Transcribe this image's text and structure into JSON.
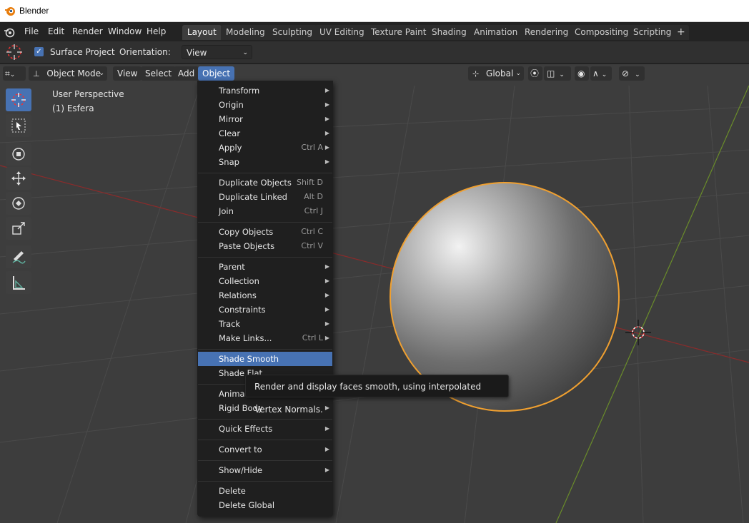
{
  "window": {
    "title": "Blender"
  },
  "topmenu": [
    "File",
    "Edit",
    "Render",
    "Window",
    "Help"
  ],
  "workspaces": [
    {
      "label": "Layout",
      "active": true
    },
    {
      "label": "Modeling"
    },
    {
      "label": "Sculpting"
    },
    {
      "label": "UV Editing"
    },
    {
      "label": "Texture Paint"
    },
    {
      "label": "Shading"
    },
    {
      "label": "Animation"
    },
    {
      "label": "Rendering"
    },
    {
      "label": "Compositing"
    },
    {
      "label": "Scripting"
    }
  ],
  "add_workspace": "+",
  "tool_settings": {
    "surface_project_label": "Surface Project",
    "surface_project_checked": true,
    "orientation_label": "Orientation:",
    "orientation_value": "View"
  },
  "viewport_header": {
    "mode": "Object Mode",
    "menus": [
      "View",
      "Select",
      "Add",
      "Object"
    ],
    "transform_orientation": "Global"
  },
  "viewport": {
    "perspective": "User Perspective",
    "active_object": "(1) Esfera"
  },
  "object_menu": {
    "items": [
      {
        "label": "Transform",
        "submenu": true
      },
      {
        "label": "Origin",
        "submenu": true
      },
      {
        "label": "Mirror",
        "submenu": true
      },
      {
        "label": "Clear",
        "submenu": true
      },
      {
        "label": "Apply",
        "shortcut": "Ctrl A",
        "submenu": true
      },
      {
        "label": "Snap",
        "submenu": true
      },
      {
        "label": "Duplicate Objects",
        "shortcut": "Shift D"
      },
      {
        "label": "Duplicate Linked",
        "shortcut": "Alt D"
      },
      {
        "label": "Join",
        "shortcut": "Ctrl J"
      },
      {
        "label": "Copy Objects",
        "shortcut": "Ctrl C"
      },
      {
        "label": "Paste Objects",
        "shortcut": "Ctrl V"
      },
      {
        "label": "Parent",
        "submenu": true
      },
      {
        "label": "Collection",
        "submenu": true
      },
      {
        "label": "Relations",
        "submenu": true
      },
      {
        "label": "Constraints",
        "submenu": true
      },
      {
        "label": "Track",
        "submenu": true
      },
      {
        "label": "Make Links...",
        "shortcut": "Ctrl L",
        "submenu": true
      },
      {
        "label": "Shade Smooth",
        "highlighted": true
      },
      {
        "label": "Shade Flat"
      },
      {
        "label": "Animation",
        "submenu": true
      },
      {
        "label": "Rigid Body",
        "submenu": true
      },
      {
        "label": "Quick Effects",
        "submenu": true
      },
      {
        "label": "Convert to",
        "submenu": true
      },
      {
        "label": "Show/Hide",
        "submenu": true
      },
      {
        "label": "Delete"
      },
      {
        "label": "Delete Global"
      }
    ]
  },
  "tooltip": "Render and display faces smooth, using interpolated Vertex Normals.",
  "colors": {
    "accent": "#4772b3",
    "selection_outline": "#f0a030",
    "viewport_bg": "#3d3d3d",
    "menu_bg": "#1f1f1f",
    "x_axis": "#8a2b2b",
    "y_axis": "#6a8c2a"
  }
}
